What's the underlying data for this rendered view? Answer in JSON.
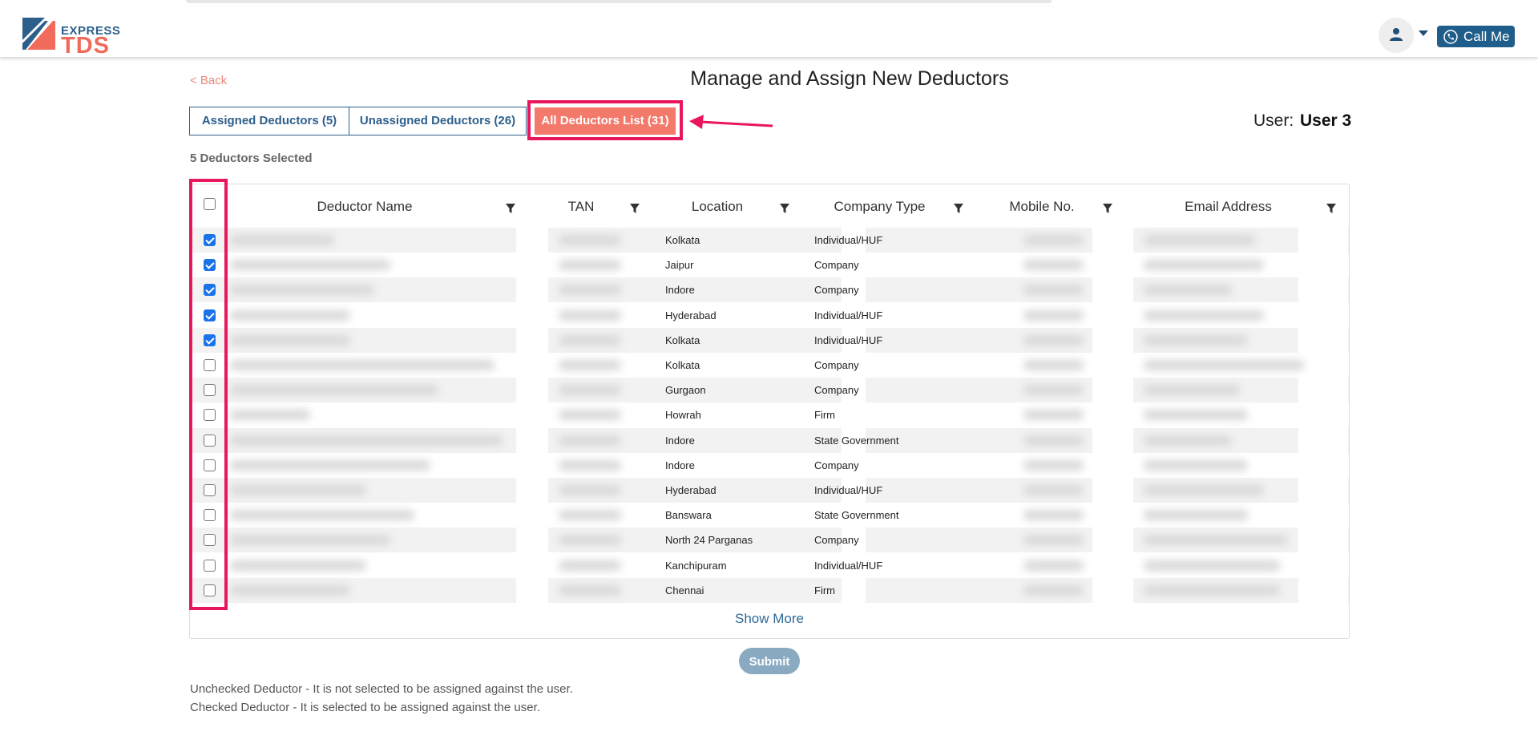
{
  "header": {
    "logo_top": "EXPRESS",
    "logo_bottom": "TDS",
    "call_label": "Call Me"
  },
  "page": {
    "back_label": "< Back",
    "title": "Manage and Assign New Deductors",
    "selected_text": "5 Deductors Selected",
    "user_label": "User:",
    "user_value": "User 3"
  },
  "tabs": [
    {
      "label": "Assigned Deductors (5)",
      "active": false
    },
    {
      "label": "Unassigned Deductors (26)",
      "active": false
    },
    {
      "label": "All Deductors List (31)",
      "active": true
    }
  ],
  "table": {
    "columns": [
      "Deductor Name",
      "TAN",
      "Location",
      "Company Type",
      "Mobile No.",
      "Email Address"
    ],
    "rows": [
      {
        "checked": true,
        "location": "Kolkata",
        "company_type": "Individual/HUF"
      },
      {
        "checked": true,
        "location": "Jaipur",
        "company_type": "Company"
      },
      {
        "checked": true,
        "location": "Indore",
        "company_type": "Company"
      },
      {
        "checked": true,
        "location": "Hyderabad",
        "company_type": "Individual/HUF"
      },
      {
        "checked": true,
        "location": "Kolkata",
        "company_type": "Individual/HUF"
      },
      {
        "checked": false,
        "location": "Kolkata",
        "company_type": "Company"
      },
      {
        "checked": false,
        "location": "Gurgaon",
        "company_type": "Company"
      },
      {
        "checked": false,
        "location": "Howrah",
        "company_type": "Firm"
      },
      {
        "checked": false,
        "location": "Indore",
        "company_type": "State Government"
      },
      {
        "checked": false,
        "location": "Indore",
        "company_type": "Company"
      },
      {
        "checked": false,
        "location": "Hyderabad",
        "company_type": "Individual/HUF"
      },
      {
        "checked": false,
        "location": "Banswara",
        "company_type": "State Government"
      },
      {
        "checked": false,
        "location": "North 24 Parganas",
        "company_type": "Company"
      },
      {
        "checked": false,
        "location": "Kanchipuram",
        "company_type": "Individual/HUF"
      },
      {
        "checked": false,
        "location": "Chennai",
        "company_type": "Firm"
      }
    ],
    "show_more_label": "Show More"
  },
  "submit_label": "Submit",
  "notes": [
    "Unchecked Deductor - It is not selected to be assigned against the user.",
    "Checked Deductor - It is selected to be assigned against the user."
  ],
  "colors": {
    "accent_blue": "#2d5f8b",
    "active_tab": "#f3796b",
    "annotation": "#e8175d",
    "checkbox_checked": "#1a73e8"
  }
}
